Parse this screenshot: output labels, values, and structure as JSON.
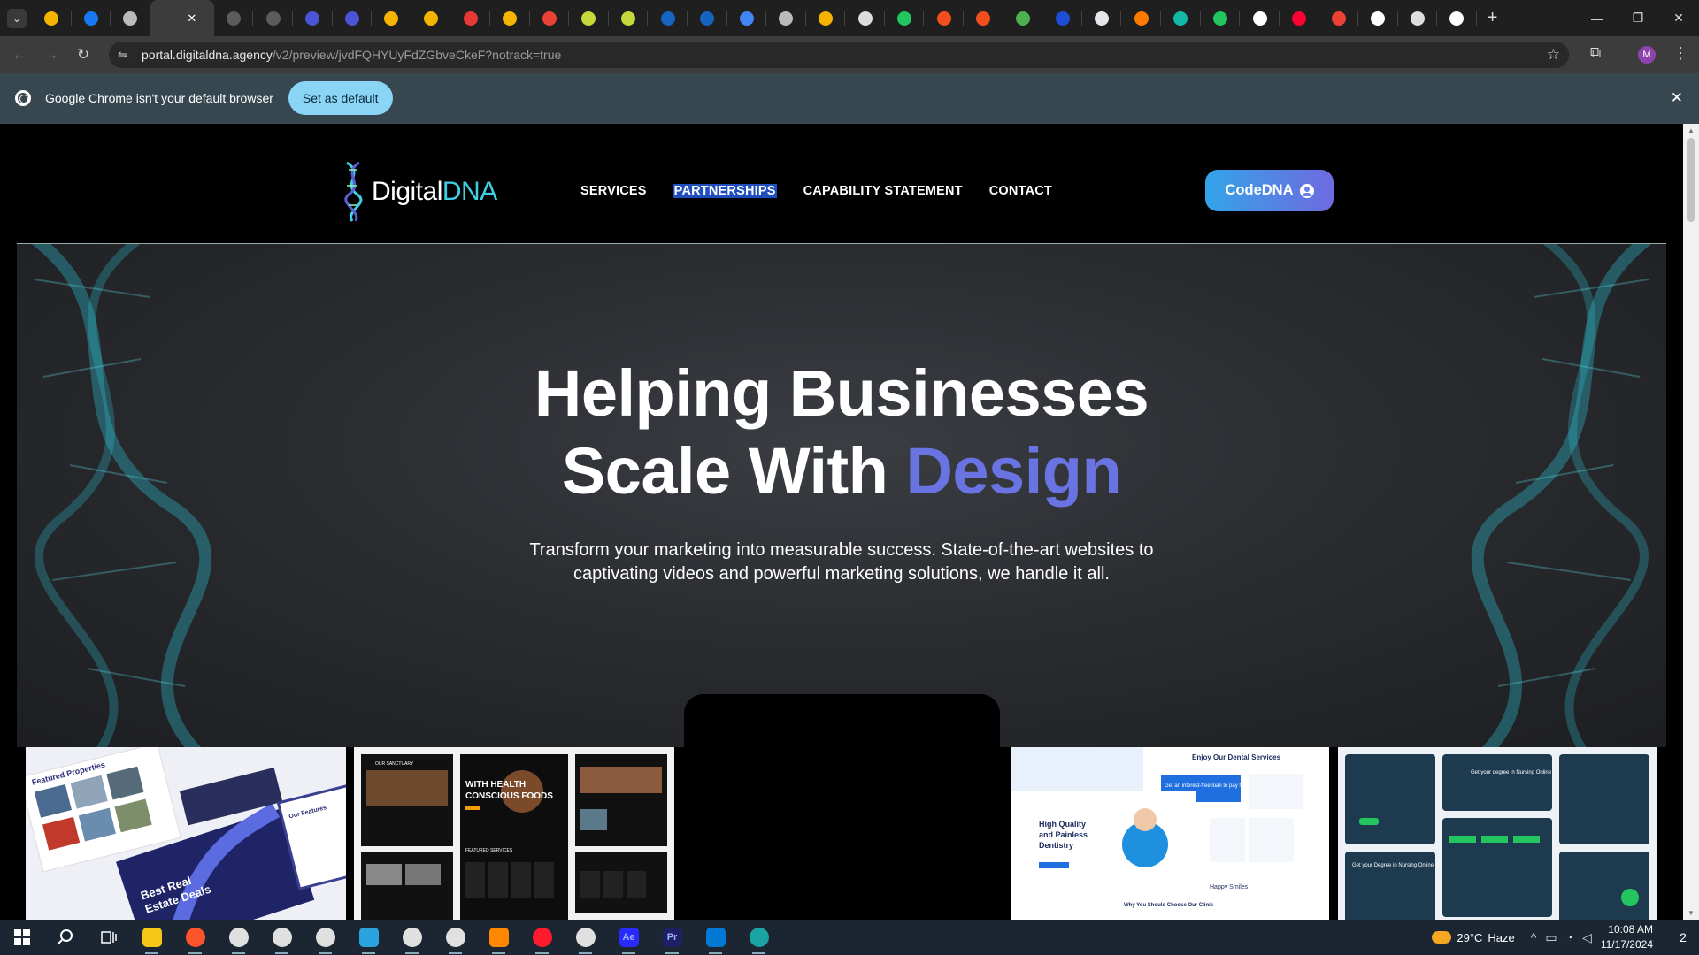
{
  "browser": {
    "tab_favicon_colors": [
      "#f4b400",
      "#1877f2",
      "#bbb",
      "#5c5c5c",
      "#5c5c5c",
      "#5c5c5c",
      "#4b53d6",
      "#4b53d6",
      "#f4b400",
      "#f4b400",
      "#e53935",
      "#f4b400",
      "#ea4335",
      "#c6d83b",
      "#c6d83b",
      "#1565c0",
      "#1565c0",
      "#4285f4",
      "#bbb",
      "#f4b400",
      "#ddd",
      "#22c55e",
      "#f24e1e",
      "#f24e1e",
      "#4caf50",
      "#1d4ed8",
      "#e5e7eb",
      "#ff7a00",
      "#14b8a6",
      "#22c55e",
      "#ffffff",
      "#ff0033",
      "#ea4335",
      "#ffffff",
      "#dddddd",
      "#ffffff"
    ],
    "active_tab_close": "✕",
    "new_tab": "+",
    "window_controls": [
      "—",
      "❐",
      "✕"
    ],
    "url_host": "portal.digitaldna.agency",
    "url_path": "/v2/preview/jvdFQHYUyFdZGbveCkeF?notrack=true",
    "profile_initial": "M",
    "icons": {
      "back": "←",
      "forward": "→",
      "reload": "↻",
      "tune": "⇋",
      "star": "☆",
      "extensions": "⧉",
      "menu": "⋮"
    }
  },
  "infobar": {
    "message": "Google Chrome isn't your default browser",
    "button": "Set as default",
    "close": "✕"
  },
  "site": {
    "logo_main": "Digital",
    "logo_accent": "DNA",
    "nav": [
      "SERVICES",
      "PARTNERSHIPS",
      "CAPABILITY STATEMENT",
      "CONTACT"
    ],
    "nav_selected": "PARTNERSHIPS",
    "cta": "CodeDNA",
    "colors": {
      "accent": "#6a73e2",
      "cta_start": "#33a4e8",
      "cta_end": "#6f6ae0",
      "logo_accent": "#3fd0e6",
      "helix": "#2ec4d6"
    }
  },
  "hero": {
    "title_line1": "Helping Businesses",
    "title_line2_prefix": "Scale With ",
    "title_line2_accent": "Design",
    "subtitle": "Transform your marketing into measurable success. State-of-the-art websites to captivating videos and powerful marketing solutions, we handle it all."
  },
  "thumbnails": {
    "t1": {
      "lines": [
        "Best Real",
        "Estate Deals"
      ],
      "title": "Featured Properties",
      "side": "Our Features"
    },
    "t2": {
      "headline": [
        "WITH HEALTH",
        "CONSCIOUS FOODS"
      ],
      "label": "FEATURED SERVICES",
      "top": "OUR SANCTUARY"
    },
    "t3": {
      "title": "Enjoy Our Dental Services",
      "card": "Get an interest-free loan to pay for your treatment",
      "headline": [
        "High Quality",
        "and Painless",
        "Dentistry"
      ],
      "why": "Why You Should Choose Our Clinic",
      "happy": "Happy Smiles"
    },
    "t4": {
      "card1": "Get your degree in Nursing Online",
      "card2": "Get your Degree in Nursing Online"
    }
  },
  "taskbar": {
    "app_colors": [
      "#f5c518",
      "#fb542b",
      "#e0e0e0",
      "#e0e0e0",
      "#e0e0e0",
      "#2aa3de",
      "#e0e0e0",
      "#e0e0e0",
      "#ff8800",
      "#ff1b2d",
      "#e0e0e0",
      "#2a2aff",
      "#1f1f66",
      "#0078d4",
      "#1aa3a3"
    ],
    "app_names": [
      "file-explorer",
      "brave",
      "chrome-profile-m",
      "chrome",
      "chrome-profile-c",
      "telegram",
      "chrome-profile-m2",
      "chrome-2",
      "vlc",
      "opera",
      "chrome-profile-k",
      "after-effects",
      "premiere-pro",
      "vscode",
      "edge"
    ],
    "app_labels": {
      "after-effects": "Ae",
      "premiere-pro": "Pr"
    },
    "weather_temp": "29°C",
    "weather_text": "Haze",
    "time": "10:08 AM",
    "date": "11/17/2024",
    "notifications": "2",
    "tray_icons": {
      "chevron": "^",
      "tablet": "▭",
      "wifi": "◔",
      "volume": "◁"
    }
  }
}
